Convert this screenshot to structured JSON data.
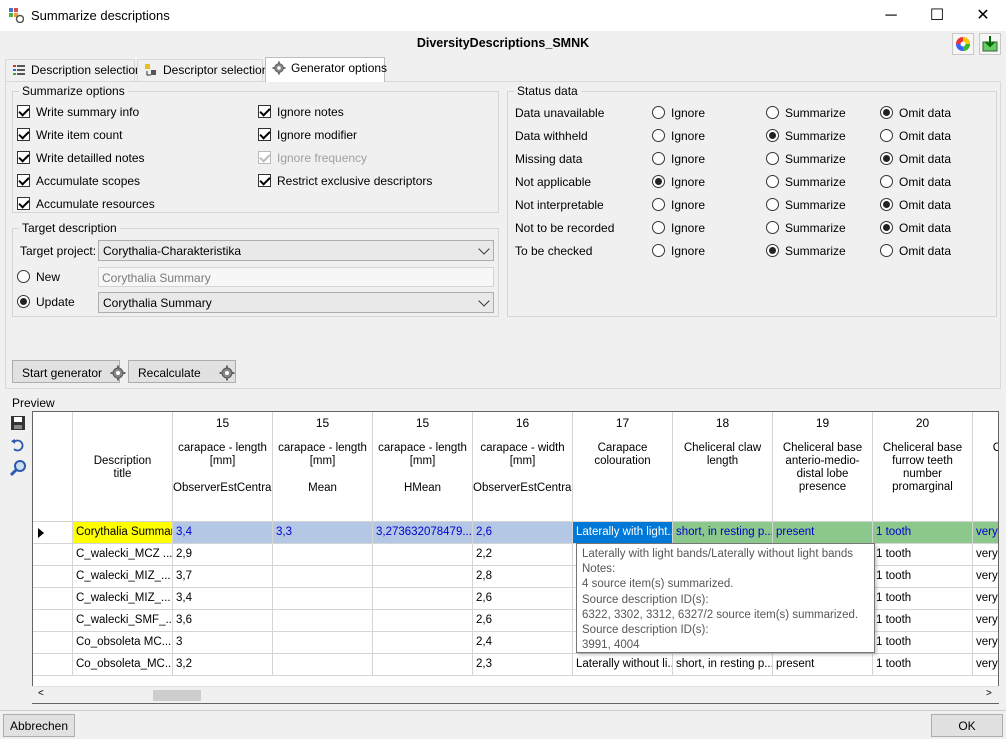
{
  "window": {
    "title": "Summarize descriptions",
    "minimize": "─",
    "maximize": "☐",
    "close": "✕"
  },
  "project_title": "DiversityDescriptions_SMNK",
  "tabs": [
    {
      "label": "Description selection"
    },
    {
      "label": "Descriptor selection"
    },
    {
      "label": "Generator options"
    }
  ],
  "summarize_options": {
    "title": "Summarize options",
    "items": [
      {
        "label": "Write summary info",
        "checked": true,
        "enabled": true
      },
      {
        "label": "Write item count",
        "checked": true,
        "enabled": true
      },
      {
        "label": "Write detailled notes",
        "checked": true,
        "enabled": true
      },
      {
        "label": "Accumulate scopes",
        "checked": true,
        "enabled": true
      },
      {
        "label": "Accumulate resources",
        "checked": true,
        "enabled": true
      },
      {
        "label": "Ignore notes",
        "checked": true,
        "enabled": true
      },
      {
        "label": "Ignore modifier",
        "checked": true,
        "enabled": true
      },
      {
        "label": "Ignore frequency",
        "checked": true,
        "enabled": false
      },
      {
        "label": "Restrict exclusive descriptors",
        "checked": true,
        "enabled": true
      }
    ]
  },
  "target": {
    "title": "Target description",
    "project_label": "Target project:",
    "project_value": "Corythalia-Charakteristika",
    "new_label": "New",
    "new_value": "Corythalia Summary",
    "update_label": "Update",
    "update_value": "Corythalia Summary",
    "mode": "update"
  },
  "status_data": {
    "title": "Status data",
    "options": [
      "Ignore",
      "Summarize",
      "Omit data"
    ],
    "rows": [
      {
        "label": "Data unavailable",
        "selected": 2
      },
      {
        "label": "Data withheld",
        "selected": 1
      },
      {
        "label": "Missing data",
        "selected": 2
      },
      {
        "label": "Not applicable",
        "selected": 0
      },
      {
        "label": "Not interpretable",
        "selected": 2
      },
      {
        "label": "Not to be recorded",
        "selected": 2
      },
      {
        "label": "To be checked",
        "selected": 1
      }
    ]
  },
  "buttons": {
    "start": "Start generator",
    "recalc": "Recalculate",
    "cancel": "Abbrechen",
    "ok": "OK"
  },
  "preview": {
    "label": "Preview",
    "first_col": "Description title",
    "columns": [
      {
        "num": "15",
        "name": "carapace - length [mm]",
        "stat": "ObserverEstCentral"
      },
      {
        "num": "15",
        "name": "carapace - length [mm]",
        "stat": "Mean"
      },
      {
        "num": "15",
        "name": "carapace - length [mm]",
        "stat": "HMean"
      },
      {
        "num": "16",
        "name": "carapace - width [mm]",
        "stat": "ObserverEstCentral"
      },
      {
        "num": "17",
        "name": "Carapace colouration",
        "stat": ""
      },
      {
        "num": "18",
        "name": "Cheliceral claw length",
        "stat": ""
      },
      {
        "num": "19",
        "name": "Cheliceral base anterio-medio-distal lobe presence",
        "stat": ""
      },
      {
        "num": "20",
        "name": "Cheliceral base furrow teeth number promarginal",
        "stat": ""
      },
      {
        "num": "",
        "name": "C ba sh pro",
        "stat": ""
      }
    ],
    "rows": [
      [
        "Corythalia Summary",
        "3,4",
        "3,3",
        "3,273632078479...",
        "2,6",
        "Laterally with light...",
        "short, in resting p...",
        "present",
        "1 tooth",
        "very"
      ],
      [
        "C_walecki_MCZ ...",
        "2,9",
        "",
        "",
        "2,2",
        "",
        "",
        "",
        "1 tooth",
        "very"
      ],
      [
        "C_walecki_MIZ_...",
        "3,7",
        "",
        "",
        "2,8",
        "",
        "",
        "",
        "1 tooth",
        "very"
      ],
      [
        "C_walecki_MIZ_...",
        "3,4",
        "",
        "",
        "2,6",
        "",
        "",
        "",
        "1 tooth",
        "very"
      ],
      [
        "C_walecki_SMF_...",
        "3,6",
        "",
        "",
        "2,6",
        "",
        "",
        "",
        "1 tooth",
        "very"
      ],
      [
        "Co_obsoleta MC...",
        "3",
        "",
        "",
        "2,4",
        "",
        "",
        "",
        "1 tooth",
        "very"
      ],
      [
        "Co_obsoleta_MC...",
        "3,2",
        "",
        "",
        "2,3",
        "Laterally without li...",
        "short, in resting p...",
        "present",
        "1 tooth",
        "very"
      ]
    ],
    "tooltip": [
      "Laterally with light bands/Laterally without light bands",
      "Notes:",
      "4 source item(s) summarized.",
      "Source description ID(s):",
      "6322, 3302, 3312, 6327/2 source item(s) summarized.",
      "Source description ID(s):",
      "3991, 4004"
    ]
  },
  "colors": {
    "highlight_yellow": "#ffff00",
    "selected_blue": "#b4c8e6",
    "text_blue": "#0000cc",
    "active_cell": "#0078d7",
    "green": "#8cc88c"
  }
}
